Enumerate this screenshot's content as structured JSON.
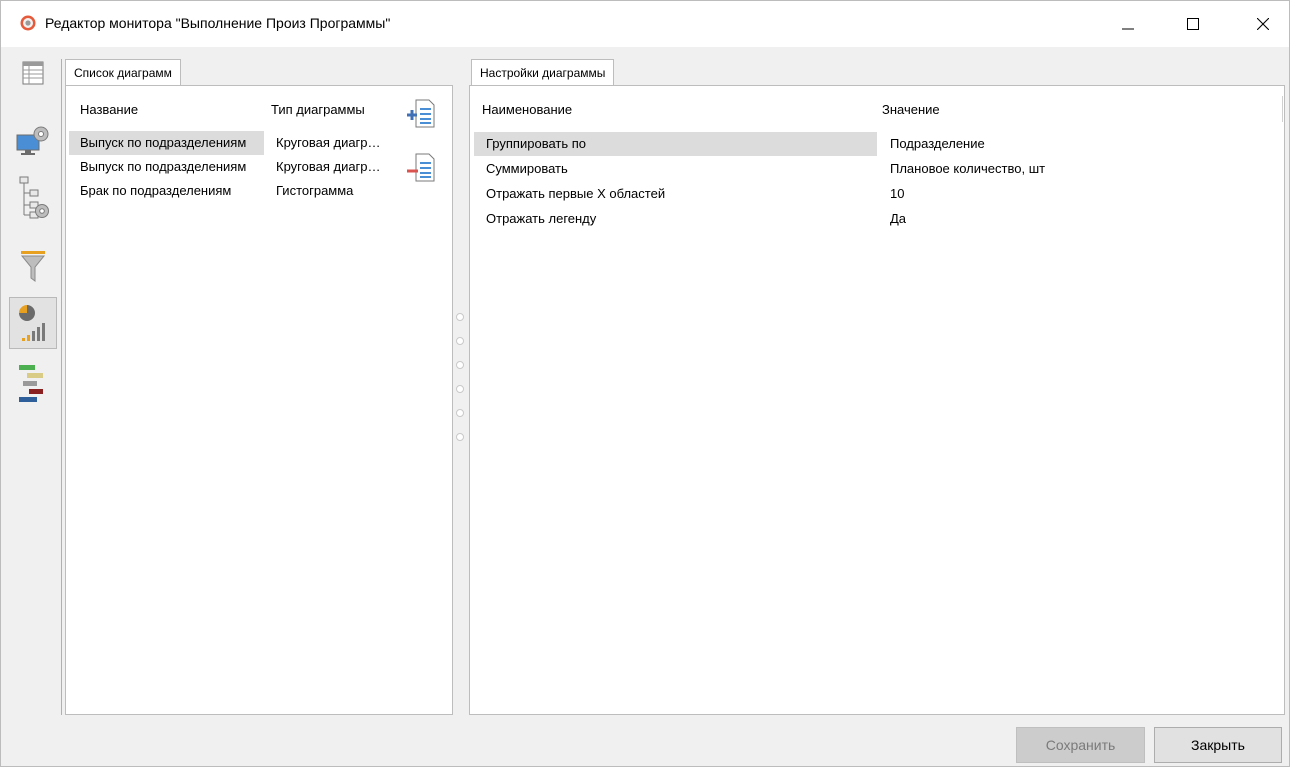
{
  "window": {
    "title": "Редактор монитора \"Выполнение Произ Программы\""
  },
  "left_toolbar": {
    "items": [
      {
        "icon": "table-icon",
        "active": false
      },
      {
        "icon": "monitor-settings-icon",
        "active": false
      },
      {
        "icon": "tree-settings-icon",
        "active": false
      },
      {
        "icon": "filter-icon",
        "active": false
      },
      {
        "icon": "pie-bar-chart-icon",
        "active": true
      },
      {
        "icon": "gantt-icon",
        "active": false
      }
    ]
  },
  "diagram_list": {
    "tab_label": "Список диаграмм",
    "columns": {
      "name": "Название",
      "type": "Тип диаграммы"
    },
    "rows": [
      {
        "name": "Выпуск по подразделениям",
        "type": "Круговая диаграмма",
        "selected": true
      },
      {
        "name": "Выпуск по подразделениям",
        "type": "Круговая диаграмма",
        "selected": false
      },
      {
        "name": "Брак по подразделениям",
        "type": "Гистограмма",
        "selected": false
      }
    ],
    "add_icon": "add-list-icon",
    "remove_icon": "remove-list-icon"
  },
  "diagram_settings": {
    "tab_label": "Настройки диаграммы",
    "columns": {
      "name": "Наименование",
      "value": "Значение"
    },
    "rows": [
      {
        "name": "Группировать по",
        "value": "Подразделение",
        "selected": true
      },
      {
        "name": "Суммировать",
        "value": "Плановое количество, шт",
        "selected": false
      },
      {
        "name": "Отражать первые X областей",
        "value": "10",
        "selected": false
      },
      {
        "name": "Отражать легенду",
        "value": "Да",
        "selected": false
      }
    ]
  },
  "footer": {
    "save_label": "Сохранить",
    "close_label": "Закрыть"
  },
  "colors": {
    "selection": "#dcdcdc",
    "add_accent": "#3f6fb5",
    "remove_accent": "#d9534f",
    "chart_orange": "#e8a020"
  }
}
